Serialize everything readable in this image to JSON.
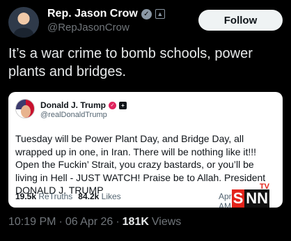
{
  "author": {
    "display_name": "Rep. Jason Crow",
    "handle": "@RepJasonCrow",
    "verified_icon": "check-badge-icon",
    "gov_icon": "government-badge-icon"
  },
  "follow_label": "Follow",
  "tweet_text": "It’s a war crime to bomb schools, power plants and bridges.",
  "quote": {
    "display_name": "Donald J. Trump",
    "handle": "@realDonaldTrump",
    "text": "Tuesday will be Power Plant Day, and Bridge Day, all wrapped up in one, in Iran. There will be nothing like it!!! Open the Fuckin’ Strait, you crazy bastards, or you’ll be living in Hell - JUST WATCH! Praise be to Allah. President DONALD J. TRUMP",
    "retruths_count": "19.5k",
    "retruths_label": "ReTruths",
    "likes_count": "84.2k",
    "likes_label": "Likes",
    "date": "Apr 05, 2",
    "date_tail": "AM"
  },
  "watermark": {
    "s": "S",
    "nn": "NN",
    "tv": "TV"
  },
  "meta": {
    "time": "10:19 PM",
    "sep": "·",
    "date": "06 Apr 26",
    "sep2": "·",
    "views_count": "181K",
    "views_label": "Views"
  }
}
